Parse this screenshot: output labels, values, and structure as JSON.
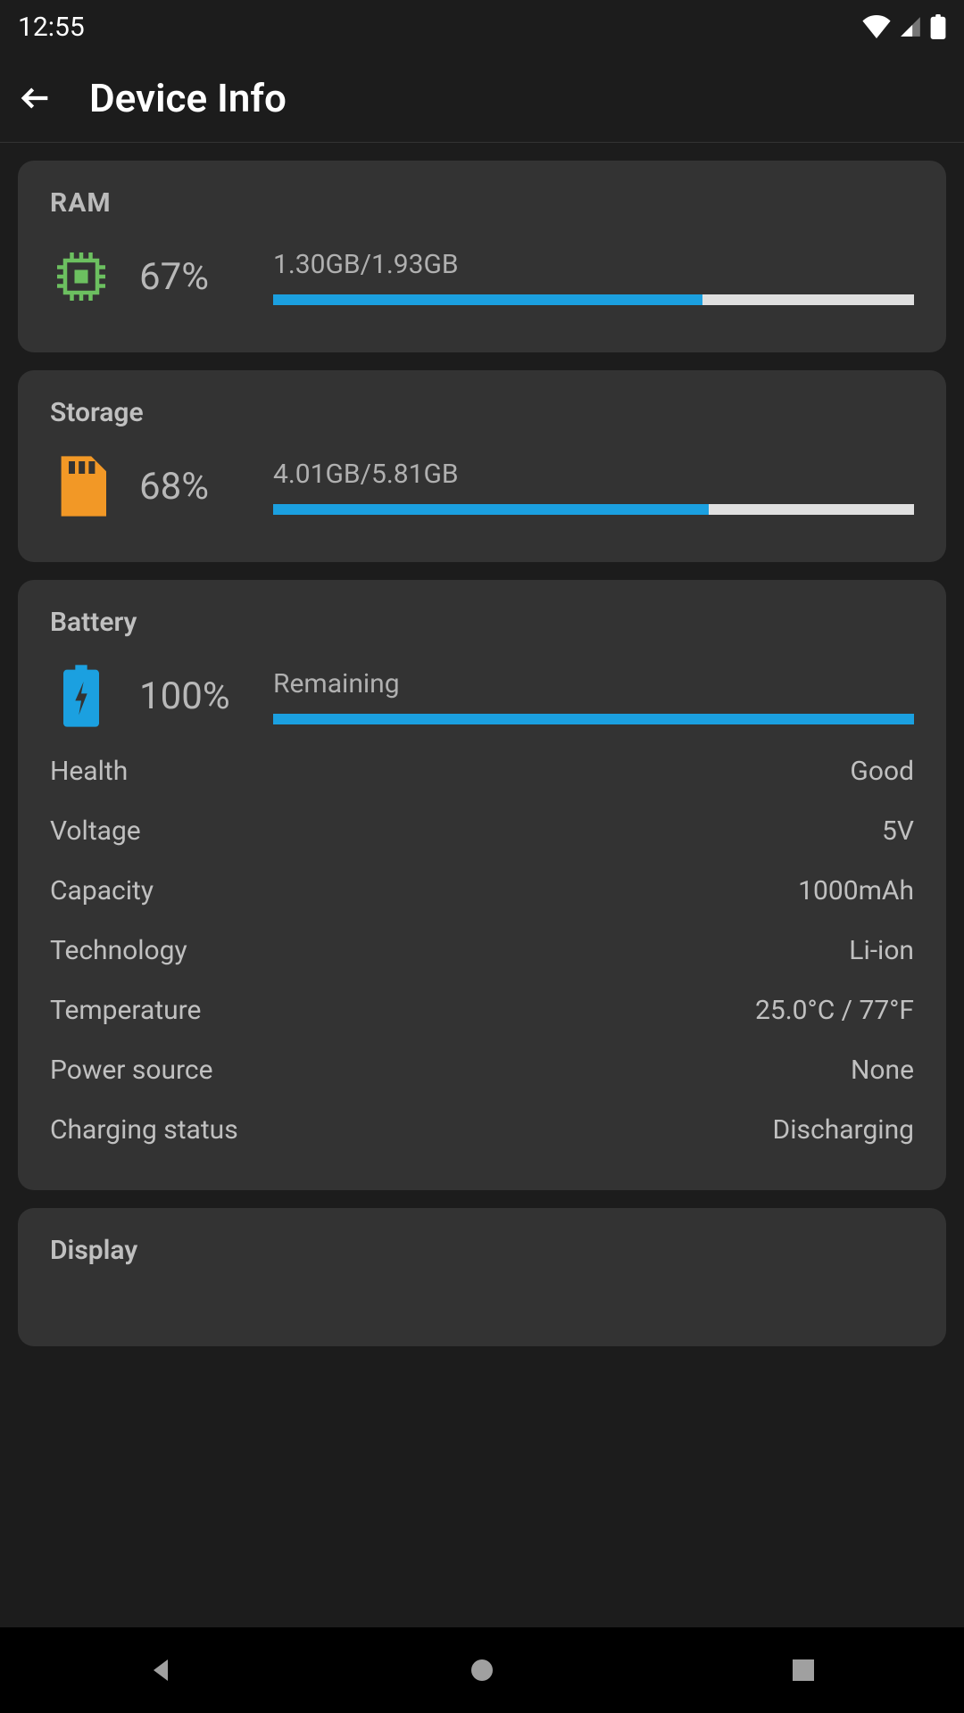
{
  "statusBar": {
    "time": "12:55"
  },
  "header": {
    "title": "Device Info"
  },
  "ram": {
    "title": "RAM",
    "percent": "67%",
    "usage": "1.30GB/1.93GB",
    "fillPercent": 67
  },
  "storage": {
    "title": "Storage",
    "percent": "68%",
    "usage": "4.01GB/5.81GB",
    "fillPercent": 68
  },
  "battery": {
    "title": "Battery",
    "percent": "100%",
    "label": "Remaining",
    "fillPercent": 100,
    "details": [
      {
        "label": "Health",
        "value": "Good"
      },
      {
        "label": "Voltage",
        "value": "5V"
      },
      {
        "label": "Capacity",
        "value": "1000mAh"
      },
      {
        "label": "Technology",
        "value": "Li-ion"
      },
      {
        "label": "Temperature",
        "value": "25.0°C / 77°F"
      },
      {
        "label": "Power source",
        "value": "None"
      },
      {
        "label": "Charging status",
        "value": "Discharging"
      }
    ]
  },
  "display": {
    "title": "Display"
  }
}
